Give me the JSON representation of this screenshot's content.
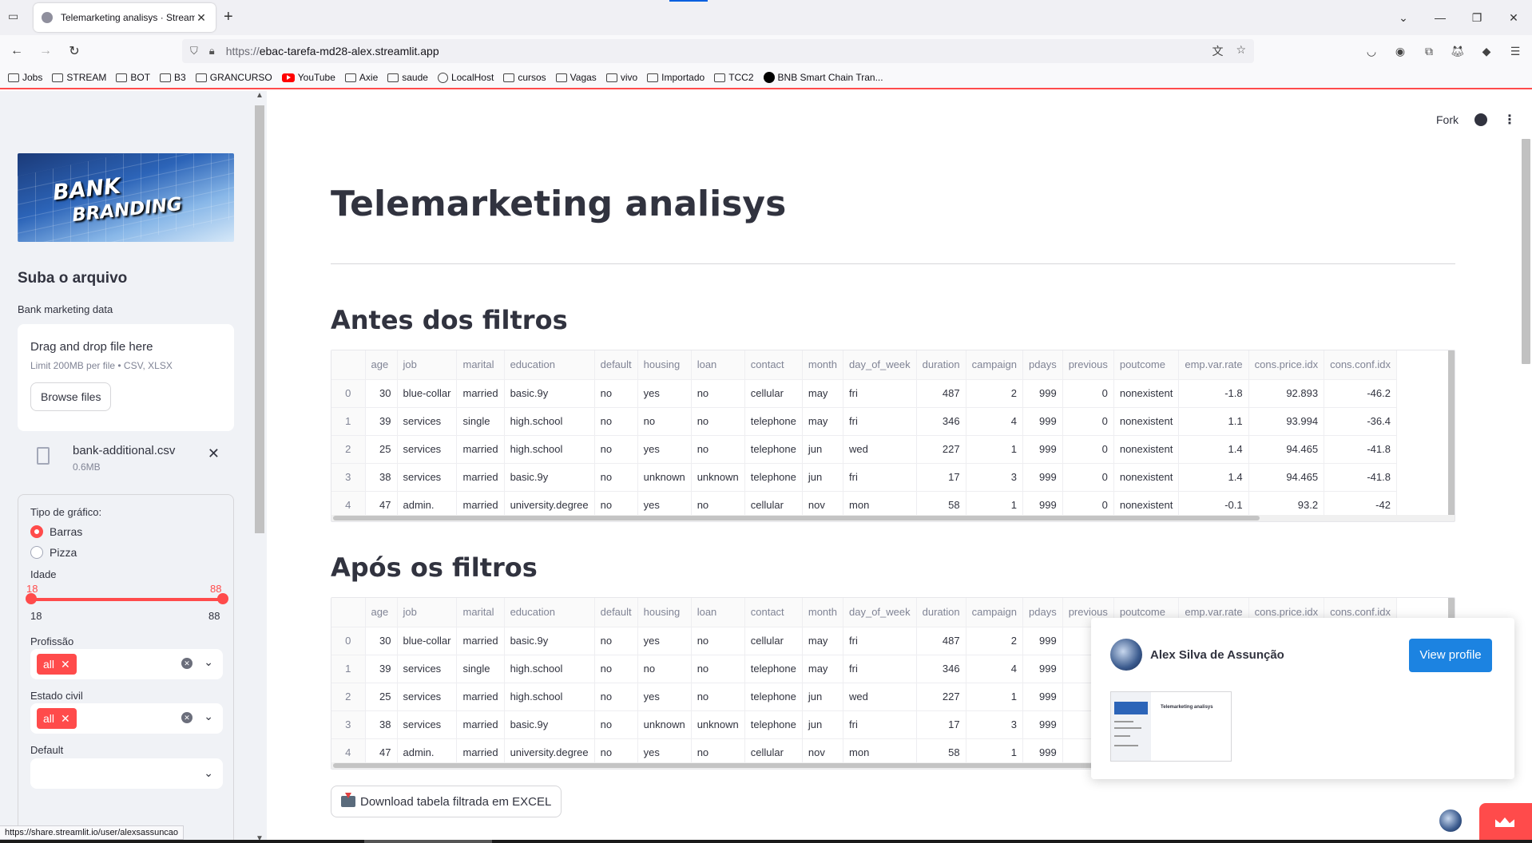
{
  "browser": {
    "tab_title": "Telemarketing analisys · Streamlit",
    "url_proto": "https://",
    "url_host": "ebac-tarefa-md28-alex.streamlit.app",
    "bookmarks": [
      {
        "label": "Jobs",
        "icon": "folder-icon"
      },
      {
        "label": "STREAM",
        "icon": "folder-icon"
      },
      {
        "label": "BOT",
        "icon": "folder-icon"
      },
      {
        "label": "B3",
        "icon": "folder-icon"
      },
      {
        "label": "GRANCURSO",
        "icon": "folder-icon"
      },
      {
        "label": "YouTube",
        "icon": "youtube-icon"
      },
      {
        "label": "Axie",
        "icon": "folder-icon"
      },
      {
        "label": "saude",
        "icon": "folder-icon"
      },
      {
        "label": "LocalHost",
        "icon": "globe-icon"
      },
      {
        "label": "cursos",
        "icon": "folder-icon"
      },
      {
        "label": "Vagas",
        "icon": "folder-icon"
      },
      {
        "label": "vivo",
        "icon": "folder-icon"
      },
      {
        "label": "Importado",
        "icon": "folder-icon"
      },
      {
        "label": "TCC2",
        "icon": "folder-icon"
      },
      {
        "label": "BNB Smart Chain Tran...",
        "icon": "bnb-icon"
      }
    ],
    "status_url": "https://share.streamlit.io/user/alexsassuncao"
  },
  "sidebar": {
    "banner_line1": "BANK",
    "banner_line2": "BRANDING",
    "upload_heading": "Suba o arquivo",
    "upload_label": "Bank marketing data",
    "drop_text": "Drag and drop file here",
    "limit_text": "Limit 200MB per file • CSV, XLSX",
    "browse_label": "Browse files",
    "file_name": "bank-additional.csv",
    "file_size": "0.6MB",
    "chart_type_label": "Tipo de gráfico:",
    "chart_options": [
      "Barras",
      "Pizza"
    ],
    "chart_selected": "Barras",
    "age_label": "Idade",
    "age_min": "18",
    "age_max": "88",
    "age_range_min": "18",
    "age_range_max": "88",
    "age_selected_fraction": [
      0.0,
      1.0
    ],
    "profession_label": "Profissão",
    "profession_chip": "all",
    "marital_label": "Estado civil",
    "marital_chip": "all",
    "default_label": "Default"
  },
  "header": {
    "fork_label": "Fork"
  },
  "main": {
    "title": "Telemarketing analisys",
    "before_heading": "Antes dos filtros",
    "after_heading": "Após os filtros",
    "download_label": "Download tabela filtrada em EXCEL"
  },
  "table": {
    "columns": [
      "",
      "age",
      "job",
      "marital",
      "education",
      "default",
      "housing",
      "loan",
      "contact",
      "month",
      "day_of_week",
      "duration",
      "campaign",
      "pdays",
      "previous",
      "poutcome",
      "emp.var.rate",
      "cons.price.idx",
      "cons.conf.idx"
    ],
    "rows": [
      [
        "0",
        "30",
        "blue-collar",
        "married",
        "basic.9y",
        "no",
        "yes",
        "no",
        "cellular",
        "may",
        "fri",
        "487",
        "2",
        "999",
        "0",
        "nonexistent",
        "-1.8",
        "92.893",
        "-46.2"
      ],
      [
        "1",
        "39",
        "services",
        "single",
        "high.school",
        "no",
        "no",
        "no",
        "telephone",
        "may",
        "fri",
        "346",
        "4",
        "999",
        "0",
        "nonexistent",
        "1.1",
        "93.994",
        "-36.4"
      ],
      [
        "2",
        "25",
        "services",
        "married",
        "high.school",
        "no",
        "yes",
        "no",
        "telephone",
        "jun",
        "wed",
        "227",
        "1",
        "999",
        "0",
        "nonexistent",
        "1.4",
        "94.465",
        "-41.8"
      ],
      [
        "3",
        "38",
        "services",
        "married",
        "basic.9y",
        "no",
        "unknown",
        "unknown",
        "telephone",
        "jun",
        "fri",
        "17",
        "3",
        "999",
        "0",
        "nonexistent",
        "1.4",
        "94.465",
        "-41.8"
      ],
      [
        "4",
        "47",
        "admin.",
        "married",
        "university.degree",
        "no",
        "yes",
        "no",
        "cellular",
        "nov",
        "mon",
        "58",
        "1",
        "999",
        "0",
        "nonexistent",
        "-0.1",
        "93.2",
        "-42"
      ]
    ]
  },
  "profile_card": {
    "name": "Alex Silva de Assunção",
    "button": "View profile",
    "thumb_title": "Telemarketing analisys"
  }
}
